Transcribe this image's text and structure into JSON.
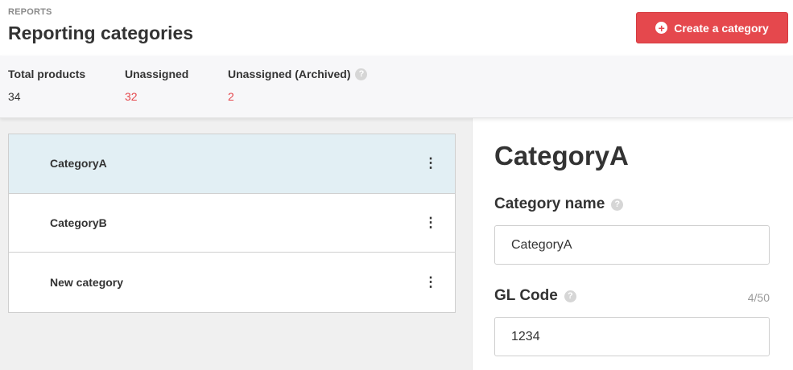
{
  "header": {
    "eyebrow": "REPORTS",
    "title": "Reporting categories",
    "create_button_label": "Create a category"
  },
  "stats": [
    {
      "label": "Total products",
      "value": "34",
      "color": "#333333"
    },
    {
      "label": "Unassigned",
      "value": "32",
      "color": "#e5484d"
    },
    {
      "label": "Unassigned (Archived)",
      "value": "2",
      "color": "#e5484d",
      "has_help": true
    }
  ],
  "categories": [
    {
      "name": "CategoryA",
      "selected": true
    },
    {
      "name": "CategoryB",
      "selected": false
    },
    {
      "name": "New category",
      "selected": false
    }
  ],
  "detail": {
    "title": "CategoryA",
    "name_label": "Category name",
    "name_value": "CategoryA",
    "gl_label": "GL Code",
    "gl_value": "1234",
    "gl_counter": "4/50"
  },
  "colors": {
    "accent": "#e5484d",
    "selected_row": "#e2eff4",
    "left_pane_bg": "#f0f0f0"
  },
  "icons": {
    "create": "plus-circle-icon",
    "help": "help-circle-icon",
    "row_menu": "kebab-menu-icon"
  }
}
